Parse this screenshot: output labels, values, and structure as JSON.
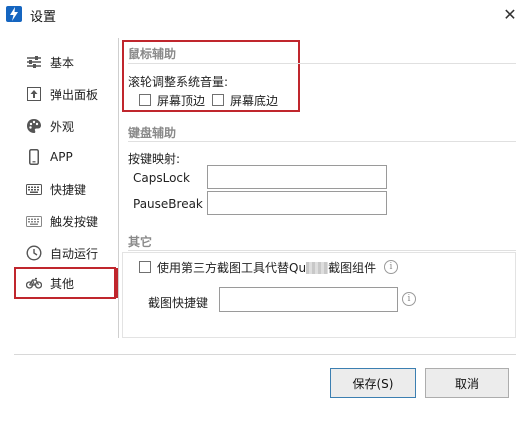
{
  "window": {
    "title": "设置"
  },
  "sidebar": {
    "items": [
      {
        "label": "基本",
        "icon": "sliders-icon"
      },
      {
        "label": "弹出面板",
        "icon": "popup-upload-icon"
      },
      {
        "label": "外观",
        "icon": "palette-icon"
      },
      {
        "label": "APP",
        "icon": "phone-icon"
      },
      {
        "label": "快捷键",
        "icon": "keyboard-icon"
      },
      {
        "label": "触发按键",
        "icon": "keyboard-trigger-icon"
      },
      {
        "label": "自动运行",
        "icon": "clock-icon"
      },
      {
        "label": "其他",
        "icon": "bicycle-icon"
      }
    ],
    "selected": "其他"
  },
  "mouse_section": {
    "title": "鼠标辅助",
    "label": "滚轮调整系统音量:",
    "options": [
      {
        "label": "屏幕顶边",
        "checked": false
      },
      {
        "label": "屏幕底边",
        "checked": false
      }
    ]
  },
  "keyboard_section": {
    "title": "键盘辅助",
    "label": "按键映射:",
    "rows": [
      {
        "label": "CapsLock",
        "value": ""
      },
      {
        "label": "PauseBreak",
        "value": ""
      }
    ]
  },
  "other_section": {
    "title": "其它",
    "third_party_prefix": "使用第三方截图工具代替Qu",
    "third_party_suffix": "截图组件",
    "third_party_checked": false,
    "hotkey_label": "截图快捷键",
    "hotkey_value": ""
  },
  "footer": {
    "save_label": "保存(S)",
    "cancel_label": "取消"
  },
  "colors": {
    "highlight": "#c0262d",
    "title_icon": "#1565c0"
  }
}
